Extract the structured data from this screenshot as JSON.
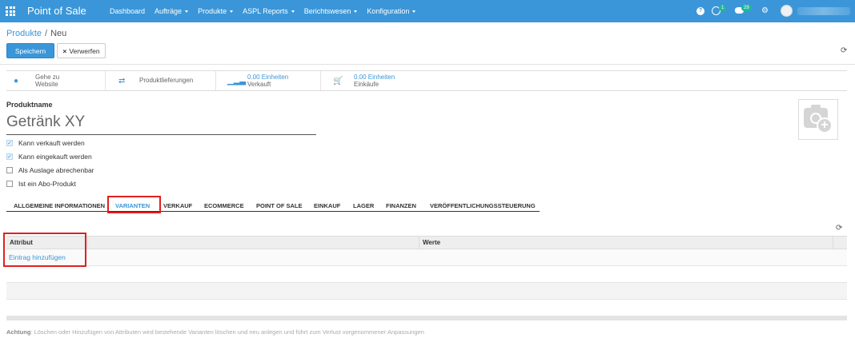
{
  "navbar": {
    "brand": "Point of Sale",
    "menu": [
      "Dashboard",
      "Aufträge",
      "Produkte",
      "ASPL Reports",
      "Berichtswesen",
      "Konfiguration"
    ],
    "activity_count": "1",
    "message_count": "29",
    "accent_color": "#3a96d8"
  },
  "breadcrumb": {
    "parent": "Produkte",
    "separator": "/",
    "current": "Neu"
  },
  "buttons": {
    "save": "Speichern",
    "discard": "Verwerfen"
  },
  "smart_buttons": [
    {
      "icon": "globe-icon",
      "line1": "Gehe zu",
      "line2": "Website"
    },
    {
      "icon": "exchange-icon",
      "line1": "Produktlieferungen",
      "line2": ""
    },
    {
      "icon": "signal-icon",
      "line1": "0.00 Einheiten",
      "line2": "Verkauft"
    },
    {
      "icon": "cart-icon",
      "line1": "0.00 Einheiten",
      "line2": "Einkäufe"
    }
  ],
  "form": {
    "name_label": "Produktname",
    "name_value": "Getränk XY",
    "checkboxes": [
      {
        "label": "Kann verkauft werden",
        "checked": true
      },
      {
        "label": "Kann eingekauft werden",
        "checked": true
      },
      {
        "label": "Als Auslage abrechenbar",
        "checked": false
      },
      {
        "label": "Ist ein Abo-Produkt",
        "checked": false
      }
    ]
  },
  "tabs": [
    "ALLGEMEINE INFORMATIONEN",
    "VARIANTEN",
    "VERKAUF",
    "ECOMMERCE",
    "POINT OF SALE",
    "EINKAUF",
    "LAGER",
    "FINANZEN",
    "VERÖFFENTLICHUNGSSTEUERUNG"
  ],
  "active_tab": "VARIANTEN",
  "attributes_table": {
    "columns": [
      "Attribut",
      "Werte"
    ],
    "add_link": "Eintrag hinzufügen"
  },
  "warning": {
    "label": "Achtung",
    "text": ": Löschen oder Hinzufügen von Attributen wird bestehende Varianten löschen und neu anlegen und führt zum Verlust vorgenommener Anpassungen"
  }
}
